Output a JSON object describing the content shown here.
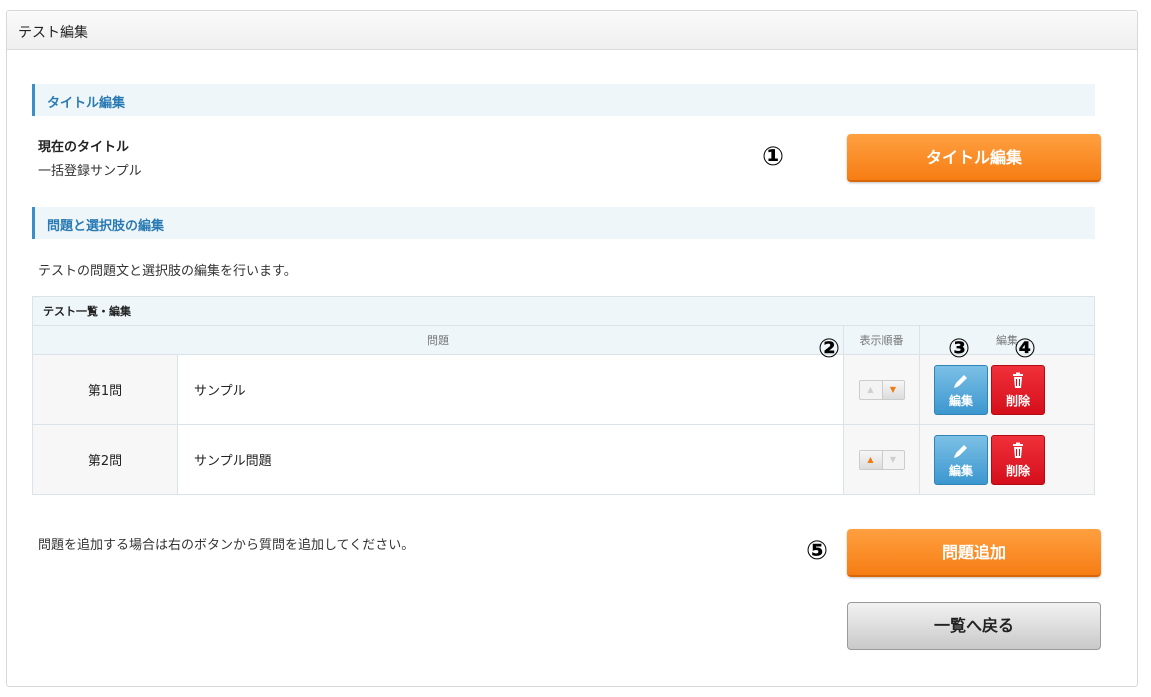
{
  "header": {
    "title": "テスト編集"
  },
  "title_section": {
    "heading": "タイトル編集",
    "current_label": "現在のタイトル",
    "current_value": "一括登録サンプル",
    "edit_button": "タイトル編集"
  },
  "questions_section": {
    "heading": "問題と選択肢の編集",
    "description": "テストの問題文と選択肢の編集を行います。",
    "table": {
      "caption": "テスト一覧・編集",
      "columns": {
        "question": "問題",
        "order": "表示順番",
        "ops": "編集"
      },
      "rows": [
        {
          "num": "第1問",
          "question": "サンプル",
          "edit_label": "編集",
          "delete_label": "削除"
        },
        {
          "num": "第2問",
          "question": "サンプル問題",
          "edit_label": "編集",
          "delete_label": "削除"
        }
      ]
    },
    "add_hint": "問題を追加する場合は右のボタンから質問を追加してください。",
    "add_button": "問題追加",
    "back_button": "一覧へ戻る"
  },
  "markers": {
    "m1": "①",
    "m2": "②",
    "m3": "③",
    "m4": "④",
    "m5": "⑤"
  },
  "colors": {
    "accent_blue": "#3a8fc8",
    "orange": "#f67d14",
    "edit_blue": "#3c97cf",
    "delete_red": "#d40f1b"
  }
}
